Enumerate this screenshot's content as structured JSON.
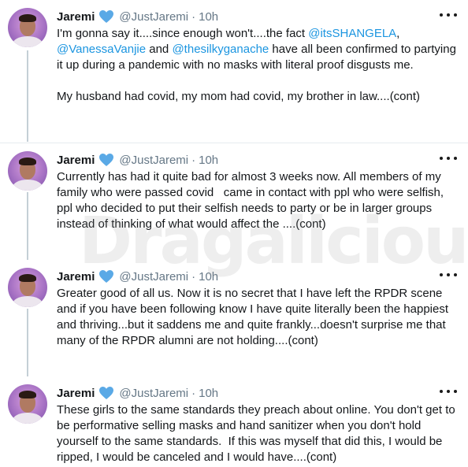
{
  "tweets": [
    {
      "name": "Jaremi",
      "handle": "@JustJaremi",
      "separator": "·",
      "time": "10h",
      "avatar_icon": "profile-photo",
      "verified_icon": "blue-heart-emoji",
      "more_icon": "more-dots-icon",
      "segments": [
        {
          "text": "I'm gonna say it....since enough won't....the fact "
        },
        {
          "text": "@itsSHANGELA",
          "mention": true
        },
        {
          "text": ", "
        },
        {
          "text": "@VanessaVanjie",
          "mention": true
        },
        {
          "text": " and "
        },
        {
          "text": "@thesilkyganache",
          "mention": true
        },
        {
          "text": " have all been confirmed to partying it up during a pandemic with no masks with literal proof disgusts me.\n\nMy husband had covid, my mom had covid, my brother in law....(cont)"
        }
      ]
    },
    {
      "name": "Jaremi",
      "handle": "@JustJaremi",
      "separator": "·",
      "time": "10h",
      "avatar_icon": "profile-photo",
      "verified_icon": "blue-heart-emoji",
      "more_icon": "more-dots-icon",
      "segments": [
        {
          "text": "Currently has had it quite bad for almost 3 weeks now. All members of my family who were passed covid   came in contact with ppl who were selfish, ppl who decided to put their selfish needs to party or be in larger groups instead of thinking of what would affect the ....(cont)"
        }
      ]
    },
    {
      "name": "Jaremi",
      "handle": "@JustJaremi",
      "separator": "·",
      "time": "10h",
      "avatar_icon": "profile-photo",
      "verified_icon": "blue-heart-emoji",
      "more_icon": "more-dots-icon",
      "segments": [
        {
          "text": "Greater good of all us. Now it is no secret that I have left the RPDR scene and if you have been following know I have quite literally been the happiest and thriving...but it saddens me and quite frankly...doesn't surprise me that many of the RPDR alumni are not holding....(cont)"
        }
      ]
    },
    {
      "name": "Jaremi",
      "handle": "@JustJaremi",
      "separator": "·",
      "time": "10h",
      "avatar_icon": "profile-photo",
      "verified_icon": "blue-heart-emoji",
      "more_icon": "more-dots-icon",
      "segments": [
        {
          "text": "These girls to the same standards they preach about online. You don't get to be performative selling masks and hand sanitizer when you don't hold yourself to the same standards.  If this was myself that did this, I would be ripped, I would be canceled and I would have....(cont)"
        }
      ]
    }
  ],
  "watermark": "Dragalicious",
  "colors": {
    "mention": "#1b95e0",
    "heart": "#5aa9e6",
    "thread_line": "#c4cfd6"
  }
}
